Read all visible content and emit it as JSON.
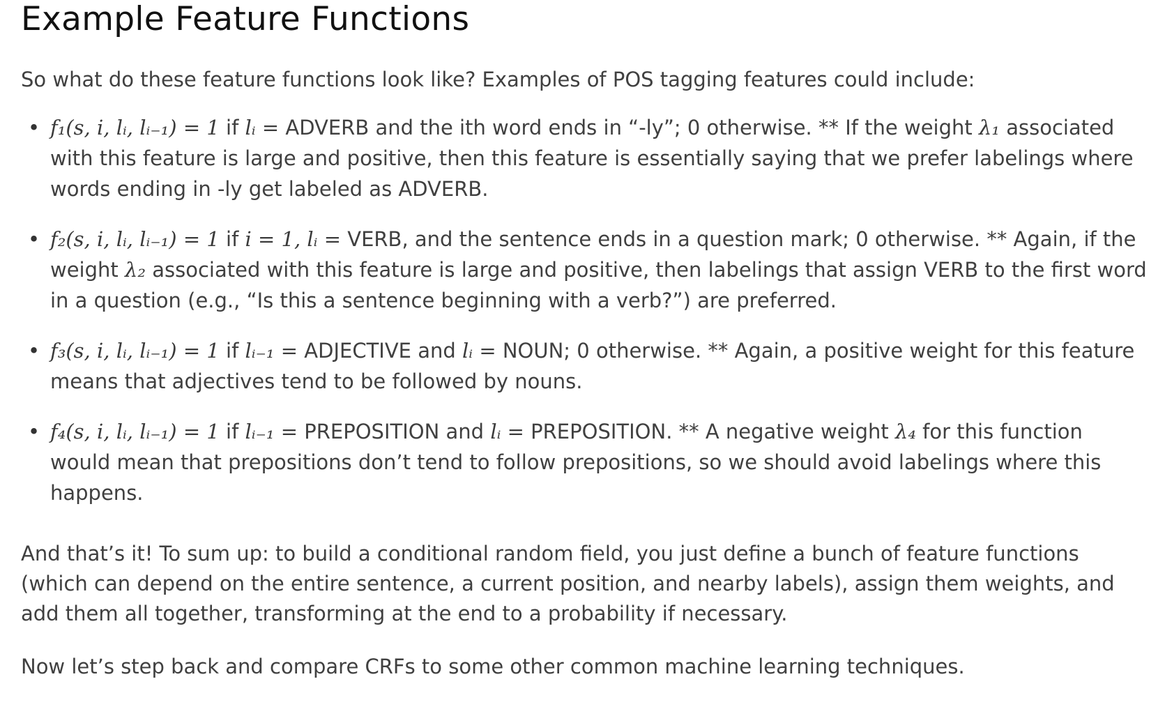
{
  "heading": "Example Feature Functions",
  "intro": "So what do these feature functions look like? Examples of POS tagging features could include:",
  "bullet_glyph": "•",
  "features": [
    {
      "func": "f₁(s, i, lᵢ, lᵢ₋₁) = 1",
      "text_a": " if ",
      "cond": "lᵢ =",
      "text_b": " ADVERB and the ith word ends in “-ly”; 0 otherwise. ** If the weight ",
      "weight": "λ₁",
      "text_c": " associated with this feature is large and positive, then this feature is essentially saying that we prefer labelings where words ending in -ly get labeled as ADVERB."
    },
    {
      "func": "f₂(s, i, lᵢ, lᵢ₋₁) = 1",
      "text_a": " if ",
      "cond": "i = 1, lᵢ =",
      "text_b": " VERB, and the sentence ends in a question mark; 0 otherwise. ** Again, if the weight ",
      "weight": "λ₂",
      "text_c": " associated with this feature is large and positive, then labelings that assign VERB to the first word in a question (e.g., “Is this a sentence beginning with a verb?”) are preferred."
    },
    {
      "func": "f₃(s, i, lᵢ, lᵢ₋₁) = 1",
      "text_a": " if ",
      "cond": "lᵢ₋₁ =",
      "text_b": " ADJECTIVE and ",
      "cond2": "lᵢ =",
      "text_c": " NOUN; 0 otherwise. ** Again, a positive weight for this feature means that adjectives tend to be followed by nouns."
    },
    {
      "func": "f₄(s, i, lᵢ, lᵢ₋₁) = 1",
      "text_a": " if ",
      "cond": "lᵢ₋₁ =",
      "text_b": " PREPOSITION and ",
      "cond2": "lᵢ =",
      "text_c": " PREPOSITION. ** A negative weight ",
      "weight": "λ₄",
      "text_d": " for this function would mean that prepositions don’t tend to follow prepositions, so we should avoid labelings where this happens."
    }
  ],
  "conclusion": "And that’s it! To sum up: to build a conditional random field, you just define a bunch of feature functions (which can depend on the entire sentence, a current position, and nearby labels), assign them weights, and add them all together, transforming at the end to a probability if necessary.",
  "next": "Now let’s step back and compare CRFs to some other common machine learning techniques."
}
